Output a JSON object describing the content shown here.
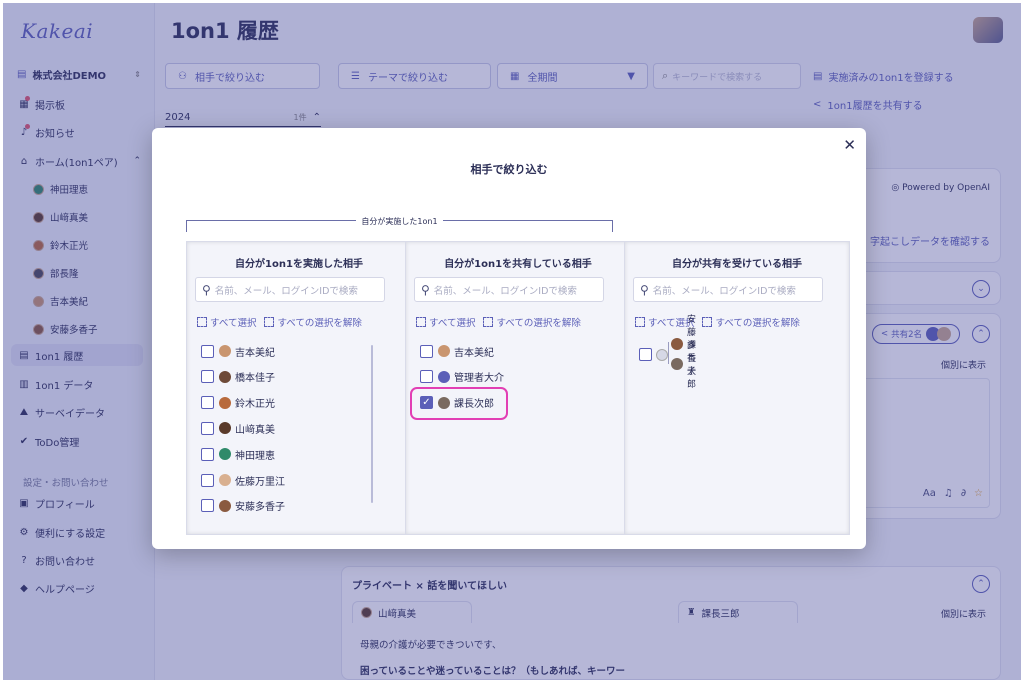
{
  "sidebar": {
    "logo": "Kakeai",
    "company": "株式会社DEMO",
    "items": [
      {
        "label": "掲示板",
        "icon": "bulletin-board-icon"
      },
      {
        "label": "お知らせ",
        "icon": "bell-icon"
      },
      {
        "label": "ホーム(1on1ペア)",
        "icon": "home-icon"
      }
    ],
    "pairs": [
      "神田理恵",
      "山﨑真美",
      "鈴木正光",
      "部長隆",
      "吉本美紀",
      "安藤多香子"
    ],
    "items2": [
      {
        "label": "1on1 履歴",
        "icon": "history-icon"
      },
      {
        "label": "1on1 データ",
        "icon": "bar-chart-icon"
      },
      {
        "label": "サーベイデータ",
        "icon": "survey-icon"
      },
      {
        "label": "ToDo管理",
        "icon": "check-circle-icon"
      }
    ],
    "section_label": "設定・お問い合わせ",
    "items3": [
      {
        "label": "プロフィール",
        "icon": "profile-icon"
      },
      {
        "label": "便利にする設定",
        "icon": "gear-icon"
      },
      {
        "label": "お問い合わせ",
        "icon": "question-icon"
      },
      {
        "label": "ヘルプページ",
        "icon": "graduation-cap-icon"
      }
    ]
  },
  "main": {
    "title": "1on1 履歴",
    "filter_partner": "相手で絞り込む",
    "filter_theme": "テーマで絞り込む",
    "period": "全期間",
    "keyword_placeholder": "キーワードで検索する",
    "register_link": "実施済みの1on1を登録する",
    "share_link": "1on1履歴を共有する",
    "year": "2024",
    "year_count": "1件",
    "powered_by": "Powered by OpenAI",
    "transcript_link": "字起こしデータを確認する",
    "shared_count": "共有2名",
    "individual_show": "個別に表示",
    "section_title": "プライベート × 話を聞いてほしい",
    "tab_person1": "山﨑真美",
    "tab_person2": "課長三郎",
    "individual_show2": "個別に表示",
    "note_line1": "母親の介護が必要できついです、",
    "note_line2": "困っていることや迷っていることは？（もしあれば、キーワー"
  },
  "modal": {
    "title": "相手で絞り込む",
    "group_label": "自分が実施した1on1",
    "search_placeholder": "名前、メール、ログインIDで検索",
    "select_all": "すべて選択",
    "deselect_all": "すべての選択を解除",
    "panels": [
      {
        "title": "自分が1on1を実施した相手",
        "people": [
          {
            "name": "吉本美紀",
            "checked": false,
            "color": "#c9956f"
          },
          {
            "name": "橋本佳子",
            "checked": false,
            "color": "#6e4a38"
          },
          {
            "name": "鈴木正光",
            "checked": false,
            "color": "#b86a3c"
          },
          {
            "name": "山﨑真美",
            "checked": false,
            "color": "#5a3a2a"
          },
          {
            "name": "神田理恵",
            "checked": false,
            "color": "#2f8a6a"
          },
          {
            "name": "佐藤万里江",
            "checked": false,
            "color": "#d9b090"
          },
          {
            "name": "安藤多香子",
            "checked": false,
            "color": "#8a5a40"
          }
        ]
      },
      {
        "title": "自分が1on1を共有している相手",
        "people": [
          {
            "name": "吉本美紀",
            "checked": false,
            "color": "#c9956f"
          },
          {
            "name": "管理者大介",
            "checked": false,
            "color": "#5b5fb8"
          },
          {
            "name": "課長次郎",
            "checked": true,
            "color": "#7a6a60"
          }
        ]
      },
      {
        "title": "自分が共有を受けている相手",
        "groups": [
          {
            "checked": false,
            "members": [
              "安藤多香子",
              "課長太郎"
            ]
          }
        ]
      }
    ]
  }
}
